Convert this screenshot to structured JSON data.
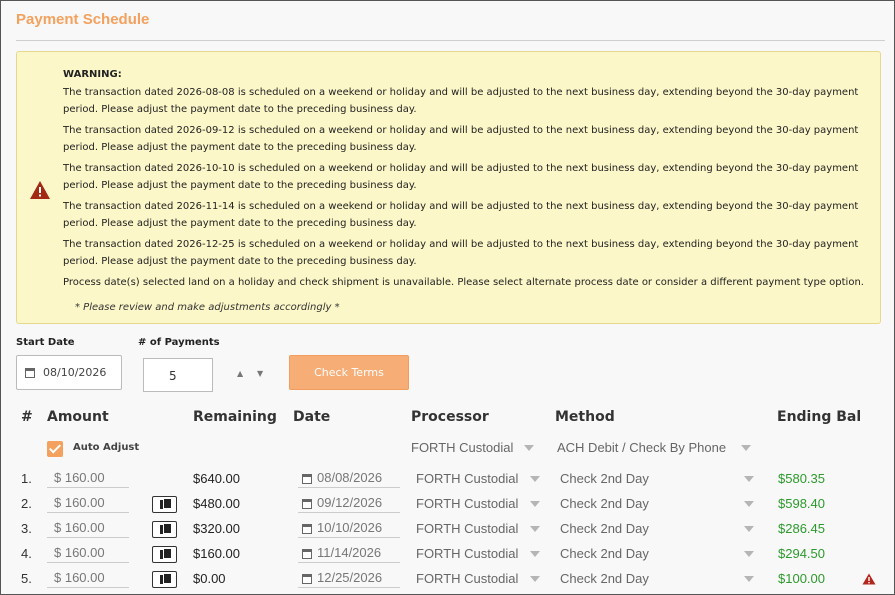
{
  "title": "Payment Schedule",
  "warning": {
    "heading": "WARNING:",
    "messages": [
      "The transaction dated 2026-08-08 is scheduled on a weekend or holiday and will be adjusted to the next business day, extending beyond the 30-day payment period. Please adjust the payment date to the preceding business day.",
      "The transaction dated 2026-09-12 is scheduled on a weekend or holiday and will be adjusted to the next business day, extending beyond the 30-day payment period. Please adjust the payment date to the preceding business day.",
      "The transaction dated 2026-10-10 is scheduled on a weekend or holiday and will be adjusted to the next business day, extending beyond the 30-day payment period. Please adjust the payment date to the preceding business day.",
      "The transaction dated 2026-11-14 is scheduled on a weekend or holiday and will be adjusted to the next business day, extending beyond the 30-day payment period. Please adjust the payment date to the preceding business day.",
      "The transaction dated 2026-12-25 is scheduled on a weekend or holiday and will be adjusted to the next business day, extending beyond the 30-day payment period. Please adjust the payment date to the preceding business day."
    ],
    "holiday_note": "Process date(s) selected land on a holiday and check shipment is unavailable. Please select alternate process date or consider a different payment type option.",
    "review_note": "* Please review and make adjustments accordingly *",
    "icon": "warning-triangle-icon",
    "icon_color": "#a32a12"
  },
  "form": {
    "start_date_label": "Start Date",
    "start_date_value": "08/10/2026",
    "payments_label": "# of Payments",
    "payments_value": "5",
    "check_terms_label": "Check Terms",
    "check_terms_color": "#f7ad76"
  },
  "table": {
    "headers": {
      "num": "#",
      "amount": "Amount",
      "remaining": "Remaining",
      "date": "Date",
      "processor": "Processor",
      "method": "Method",
      "ending": "Ending Bal"
    },
    "auto_adjust_label": "Auto Adjust",
    "auto_adjust_checked": true,
    "default_processor": "FORTH Custodial",
    "default_method": "ACH Debit / Check By Phone",
    "rows": [
      {
        "num": "1.",
        "amount": "$ 160.00",
        "remaining": "$640.00",
        "date": "08/08/2026",
        "processor": "FORTH Custodial",
        "method": "Check 2nd Day",
        "ending": "$580.35"
      },
      {
        "num": "2.",
        "amount": "$ 160.00",
        "remaining": "$480.00",
        "date": "09/12/2026",
        "processor": "FORTH Custodial",
        "method": "Check 2nd Day",
        "ending": "$598.40"
      },
      {
        "num": "3.",
        "amount": "$ 160.00",
        "remaining": "$320.00",
        "date": "10/10/2026",
        "processor": "FORTH Custodial",
        "method": "Check 2nd Day",
        "ending": "$286.45"
      },
      {
        "num": "4.",
        "amount": "$ 160.00",
        "remaining": "$160.00",
        "date": "11/14/2026",
        "processor": "FORTH Custodial",
        "method": "Check 2nd Day",
        "ending": "$294.50"
      },
      {
        "num": "5.",
        "amount": "$ 160.00",
        "remaining": "$0.00",
        "date": "12/25/2026",
        "processor": "FORTH Custodial",
        "method": "Check 2nd Day",
        "ending": "$100.00"
      }
    ]
  },
  "colors": {
    "accent": "#f4a15d",
    "ending_balance": "#2c9a2c",
    "warning_bg": "#fcf7c8"
  }
}
